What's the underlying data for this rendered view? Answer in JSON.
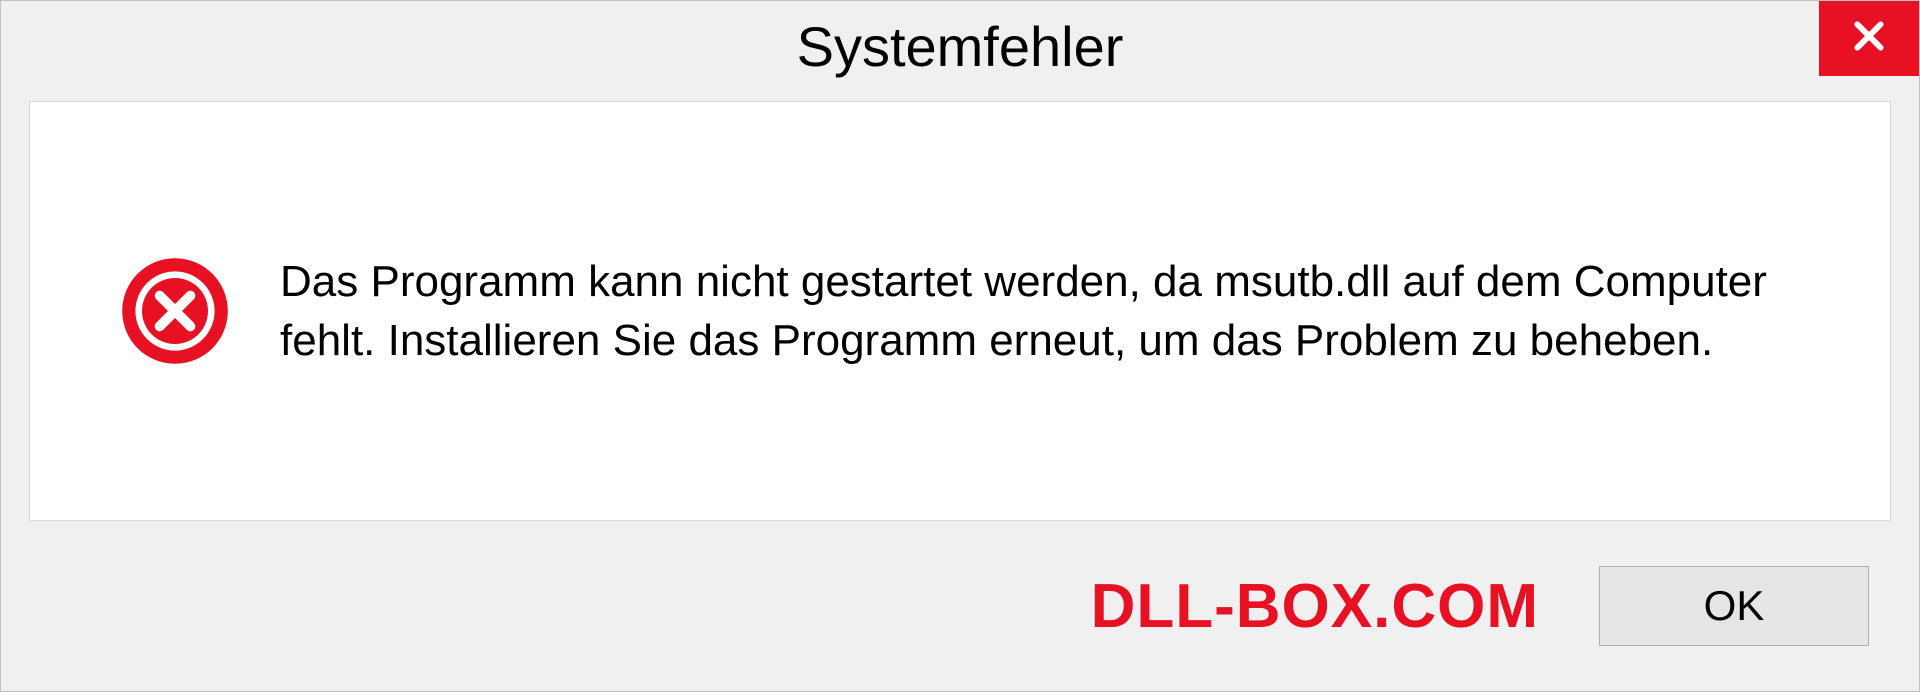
{
  "dialog": {
    "title": "Systemfehler",
    "message": "Das Programm kann nicht gestartet werden, da msutb.dll auf dem Computer fehlt. Installieren Sie das Programm erneut, um das Problem zu beheben.",
    "ok_label": "OK",
    "watermark": "DLL-BOX.COM"
  }
}
